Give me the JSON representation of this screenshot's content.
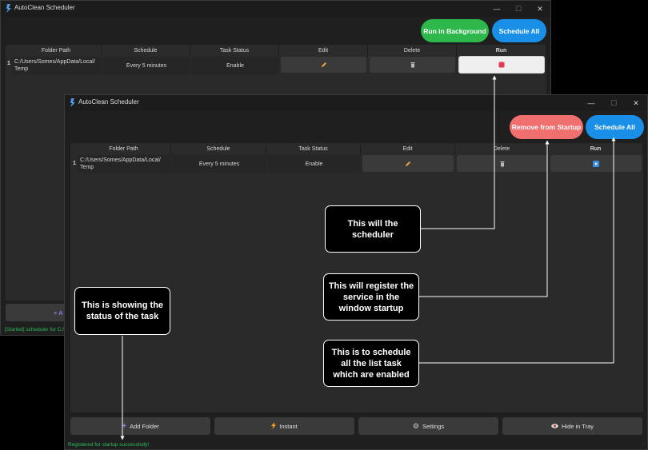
{
  "back_window": {
    "title": "AutoClean Scheduler",
    "window_controls": {
      "minimize": "—",
      "maximize": "☐",
      "close": "✕"
    },
    "buttons": {
      "background": "Run in Background",
      "schedule_all": "Schedule All"
    },
    "columns": [
      "Folder Path",
      "Schedule",
      "Task Status",
      "Edit",
      "Delete",
      "Run"
    ],
    "rows": [
      {
        "num": "1",
        "path": "C:/Users/Somes/AppData/Local/ Temp",
        "schedule": "Every 5 minutes",
        "status": "Enable",
        "run_state": "running"
      }
    ],
    "add_folder_partial": "+ A",
    "status": "[Started] scheduler for C:/"
  },
  "front_window": {
    "title": "AutoClean Scheduler",
    "window_controls": {
      "minimize": "—",
      "maximize": "☐",
      "close": "✕"
    },
    "buttons": {
      "remove_startup": "Remove from Startup",
      "schedule_all": "Schedule All"
    },
    "columns": [
      "Folder Path",
      "Schedule",
      "Task Status",
      "Edit",
      "Delete",
      "Run"
    ],
    "rows": [
      {
        "num": "1",
        "path": "C:/Users/Somes/AppData/Local/ Temp",
        "schedule": "Every 5 minutes",
        "status": "Enable",
        "run_state": "stopped"
      }
    ],
    "bottom_buttons": {
      "add_folder": "Add Folder",
      "instant": "Instant",
      "settings": "Settings",
      "hide_tray": "Hide in Tray"
    },
    "status": "Registered for startup successfully!"
  },
  "callouts": {
    "scheduler": "This will the scheduler",
    "startup": "This will register the service in the window startup",
    "schedule_all": "This is to schedule all the list task which are enabled",
    "status": "This is showing the status of the task"
  },
  "colors": {
    "green": "#2eb84b",
    "blue": "#1a8fe8",
    "salmon": "#f07070",
    "status_text": "#2ebd5b"
  },
  "icons": {
    "edit": "pencil-icon",
    "delete": "trash-icon",
    "run": "play-icon",
    "stop": "stop-icon",
    "add": "plus-icon",
    "instant": "lightning-icon",
    "settings": "gear-icon",
    "tray": "eye-icon"
  }
}
